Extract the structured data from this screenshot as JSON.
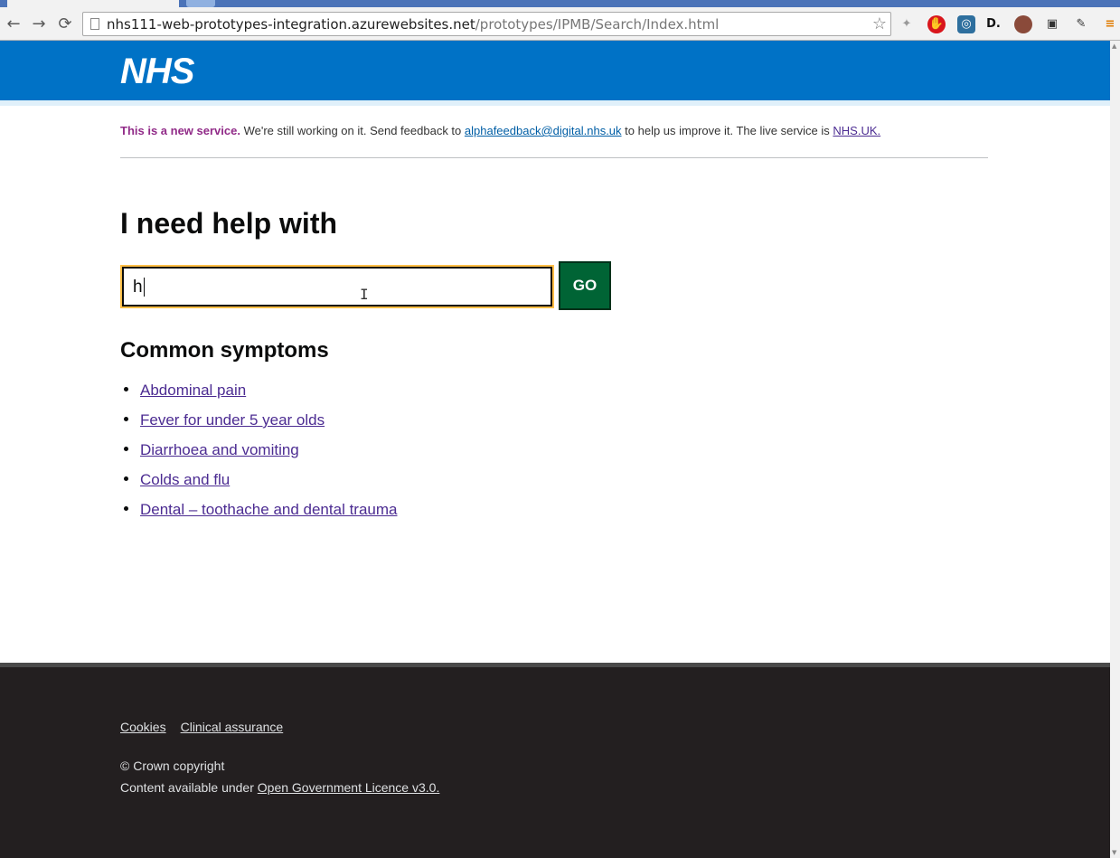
{
  "browser": {
    "url_host": "nhs111-web-prototypes-integration.azurewebsites.net",
    "url_path": "/prototypes/IPMB/Search/Index.html",
    "back_icon": "back-arrow-icon",
    "forward_icon": "forward-arrow-icon",
    "reload_icon": "reload-icon",
    "extension_d_label": "D."
  },
  "header": {
    "logo_text": "NHS",
    "brand_color": "#0072c6"
  },
  "banner": {
    "tag": "This is a new service.",
    "text_before": " We're still working on it. Send feedback to ",
    "feedback_email": "alphafeedback@digital.nhs.uk",
    "text_middle": " to help us improve it. The live service is ",
    "live_link": "NHS.UK."
  },
  "main": {
    "title": "I need help with",
    "search": {
      "value": "h"
    },
    "go_label": "GO",
    "go_color": "#006435",
    "section_heading": "Common symptoms",
    "symptoms": [
      "Abdominal pain",
      "Fever for under 5 year olds",
      "Diarrhoea and vomiting",
      "Colds and flu",
      "Dental – toothache and dental trauma"
    ]
  },
  "footer": {
    "links": [
      "Cookies",
      "Clinical assurance"
    ],
    "copyright": "© Crown copyright",
    "licence_prefix": "Content available under ",
    "licence_link": "Open Government Licence v3.0."
  }
}
